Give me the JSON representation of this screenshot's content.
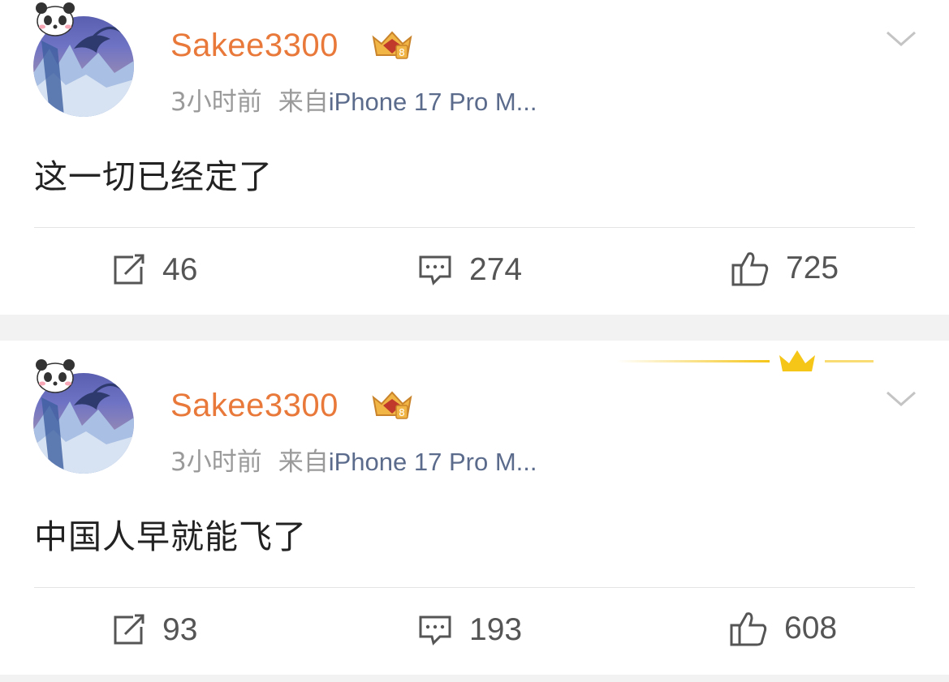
{
  "posts": [
    {
      "username": "Sakee3300",
      "time": "3小时前",
      "source_prefix": "来自",
      "device": "iPhone 17 Pro M...",
      "content": "这一切已经定了",
      "reposts": "46",
      "comments": "274",
      "likes": "725"
    },
    {
      "username": "Sakee3300",
      "time": "3小时前",
      "source_prefix": "来自",
      "device": "iPhone 17 Pro M...",
      "content": "中国人早就能飞了",
      "reposts": "93",
      "comments": "193",
      "likes": "608"
    }
  ],
  "icons": {
    "avatar_decoration": "panda-icon",
    "vip_badge": "crown-badge-icon",
    "more": "chevron-down-icon",
    "repost": "repost-icon",
    "comment": "comment-icon",
    "like": "thumbs-up-icon"
  },
  "colors": {
    "username": "#e8793a",
    "device": "#5b6b8c",
    "meta": "#9a9a9a",
    "text": "#222222",
    "background": "#f2f2f2"
  }
}
